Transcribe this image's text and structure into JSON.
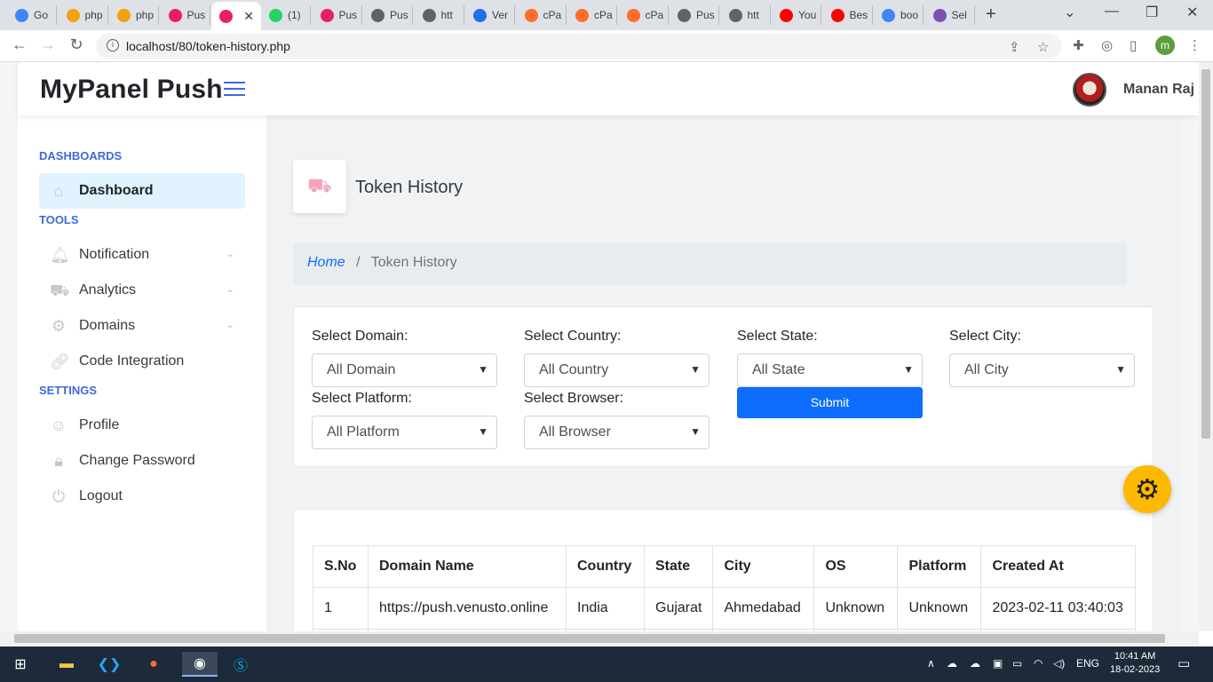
{
  "browser": {
    "tabs": [
      {
        "label": "Go",
        "icon": "google-docs-icon",
        "color": "#4285f4"
      },
      {
        "label": "php",
        "icon": "phpmyadmin-icon",
        "color": "#f0a30a"
      },
      {
        "label": "php",
        "icon": "phpmyadmin-icon",
        "color": "#f0a30a"
      },
      {
        "label": "Pus",
        "icon": "pushpanel-icon",
        "color": "#e91e63"
      },
      {
        "label": "",
        "icon": "pushpanel-icon",
        "color": "#e91e63",
        "active": true
      },
      {
        "label": "(1)",
        "icon": "whatsapp-icon",
        "color": "#25d366"
      },
      {
        "label": "Pus",
        "icon": "pushpanel-icon",
        "color": "#e91e63"
      },
      {
        "label": "Pus",
        "icon": "globe-icon",
        "color": "#5f6368"
      },
      {
        "label": "htt",
        "icon": "globe-icon",
        "color": "#5f6368"
      },
      {
        "label": "Ver",
        "icon": "cloud-icon",
        "color": "#1a73e8"
      },
      {
        "label": "cPa",
        "icon": "cpanel-icon",
        "color": "#ff6c2c"
      },
      {
        "label": "cPa",
        "icon": "cpanel-icon",
        "color": "#ff6c2c"
      },
      {
        "label": "cPa",
        "icon": "cpanel-icon",
        "color": "#ff6c2c"
      },
      {
        "label": "Pus",
        "icon": "globe-icon",
        "color": "#5f6368"
      },
      {
        "label": "htt",
        "icon": "globe-icon",
        "color": "#5f6368"
      },
      {
        "label": "You",
        "icon": "youtube-icon",
        "color": "#ff0000"
      },
      {
        "label": "Bes",
        "icon": "youtube-icon",
        "color": "#ff0000"
      },
      {
        "label": "boo",
        "icon": "google-icon",
        "color": "#4285f4"
      },
      {
        "label": "Sel",
        "icon": "bootstrap-icon",
        "color": "#7952b3"
      }
    ],
    "url": "localhost/80/token-history.php",
    "profile_initial": "m"
  },
  "header": {
    "brand": "MyPanel Push",
    "user_name": "Manan Raj"
  },
  "sidebar": {
    "sections": [
      {
        "title": "DASHBOARDS",
        "items": [
          {
            "label": "Dashboard",
            "icon": "home-icon",
            "active": true
          }
        ]
      },
      {
        "title": "TOOLS",
        "items": [
          {
            "label": "Notification",
            "icon": "bell-icon",
            "has_submenu": true
          },
          {
            "label": "Analytics",
            "icon": "car-icon",
            "has_submenu": true
          },
          {
            "label": "Domains",
            "icon": "gear-icon",
            "has_submenu": true
          },
          {
            "label": "Code Integration",
            "icon": "link-icon"
          }
        ]
      },
      {
        "title": "SETTINGS",
        "items": [
          {
            "label": "Profile",
            "icon": "user-icon"
          },
          {
            "label": "Change Password",
            "icon": "lock-icon"
          },
          {
            "label": "Logout",
            "icon": "power-icon"
          }
        ]
      }
    ]
  },
  "main": {
    "title": "Token History",
    "title_icon": "car-icon",
    "breadcrumb": {
      "home": "Home",
      "separator": "/",
      "current": "Token History"
    },
    "filters": {
      "domain": {
        "label": "Select Domain:",
        "value": "All Domain"
      },
      "country": {
        "label": "Select Country:",
        "value": "All Country"
      },
      "state": {
        "label": "Select State:",
        "value": "All State"
      },
      "city": {
        "label": "Select City:",
        "value": "All City"
      },
      "platform": {
        "label": "Select Platform:",
        "value": "All Platform"
      },
      "browser": {
        "label": "Select Browser:",
        "value": "All Browser"
      },
      "submit_label": "Submit"
    },
    "table": {
      "headers": [
        "S.No",
        "Domain Name",
        "Country",
        "State",
        "City",
        "OS",
        "Platform",
        "Created At"
      ],
      "rows": [
        [
          "1",
          "https://push.venusto.online",
          "India",
          "Gujarat",
          "Ahmedabad",
          "Unknown",
          "Unknown",
          "2023-02-11 03:40:03"
        ]
      ]
    }
  },
  "taskbar": {
    "time": "10:41 AM",
    "date": "18-02-2023",
    "language": "ENG"
  },
  "colors": {
    "accent": "#3f6ad8",
    "primary_button": "#0d6efd",
    "settings_fab": "#fcb900",
    "active_nav_bg": "#e0f3ff"
  }
}
